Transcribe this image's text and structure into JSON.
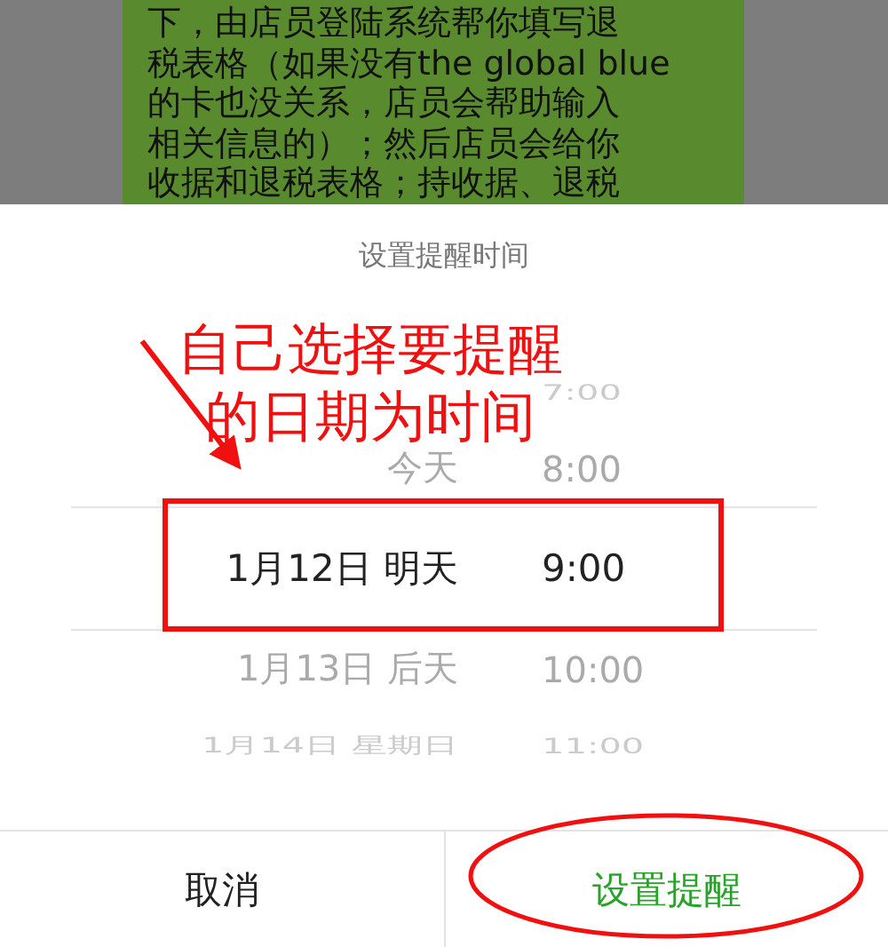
{
  "message_bubble": {
    "lines": [
      "下，由店员登陆系统帮你填写退",
      "税表格（如果没有the global blue",
      "的卡也没关系，店员会帮助输入",
      "相关信息的）；然后店员会给你",
      "收据和退税表格；持收据、退税"
    ]
  },
  "sheet": {
    "title": "设置提醒时间",
    "picker_rows": [
      {
        "time": "7:00",
        "selected": false
      },
      {
        "date": "今天",
        "time": "8:00",
        "selected": false
      },
      {
        "date": "1月12日 明天",
        "time": "9:00",
        "selected": true
      },
      {
        "date": "1月13日 后天",
        "time": "10:00",
        "selected": false
      },
      {
        "date": "1月14日 星期日",
        "time": "11:00",
        "selected": false
      }
    ],
    "buttons": [
      {
        "label": "取消",
        "kind": "cancel"
      },
      {
        "label": "设置提醒",
        "kind": "confirm"
      }
    ]
  },
  "annotation": {
    "note_lines": [
      "自己选择要提醒",
      "的日期为时间"
    ]
  }
}
